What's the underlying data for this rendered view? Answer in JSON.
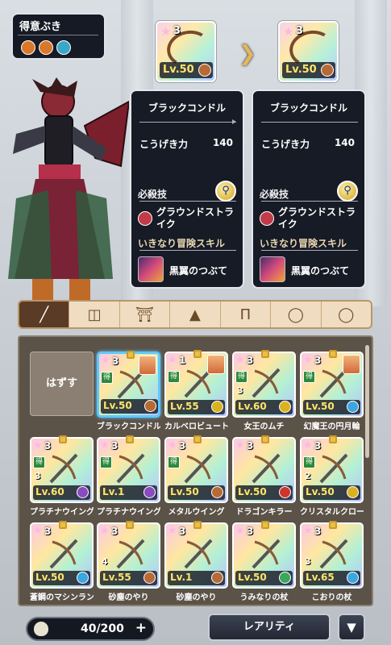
{
  "favorite": {
    "title": "得意ぶき",
    "icons": [
      {
        "name": "bow-type-icon",
        "color": "#d9782a"
      },
      {
        "name": "whip-type-icon",
        "color": "#d9782a"
      },
      {
        "name": "claw-type-icon",
        "color": "#3aa7c9"
      }
    ]
  },
  "preview": {
    "current": {
      "stars": "3",
      "level": "Lv.50"
    },
    "next": {
      "stars": "3",
      "level": "Lv.50"
    }
  },
  "panels": [
    {
      "name": "ブラックコンドル",
      "attack_label": "こうげき力",
      "attack_value": "140",
      "special_label": "必殺技",
      "skill_name": "グラウンドストライク",
      "adventure_label": "いきなり冒険スキル",
      "adventure_skill": "黒翼のつぶて"
    },
    {
      "name": "ブラックコンドル",
      "attack_label": "こうげき力",
      "attack_value": "140",
      "special_label": "必殺技",
      "skill_name": "グラウンドストライク",
      "adventure_label": "いきなり冒険スキル",
      "adventure_skill": "黒翼のつぶて"
    }
  ],
  "tabs": [
    {
      "name": "weapon",
      "icon": "sword-icon"
    },
    {
      "name": "shield",
      "icon": "shield-icon"
    },
    {
      "name": "head",
      "icon": "helmet-icon"
    },
    {
      "name": "body-top",
      "icon": "armor-icon"
    },
    {
      "name": "body-bottom",
      "icon": "pants-icon"
    },
    {
      "name": "accessory1",
      "icon": "ring-icon"
    },
    {
      "name": "accessory2",
      "icon": "ring-icon"
    }
  ],
  "unequip_label": "はずす",
  "items": [
    {
      "name": "ブラックコンドル",
      "stars": "3",
      "level": "Lv.50",
      "elem": "#b86a34",
      "toku": true,
      "plus": "",
      "selected": true,
      "avatar": true
    },
    {
      "name": "カルベロビュート",
      "stars": "1",
      "level": "Lv.55",
      "elem": "#d9b21e",
      "toku": true,
      "plus": "",
      "selected": false,
      "avatar": true
    },
    {
      "name": "女王のムチ",
      "stars": "3",
      "level": "Lv.60",
      "elem": "#d9b21e",
      "toku": true,
      "plus": "3",
      "selected": false,
      "avatar": false
    },
    {
      "name": "幻魔王の円月輪",
      "stars": "3",
      "level": "Lv.50",
      "elem": "#3aa7e0",
      "toku": true,
      "plus": "",
      "selected": false,
      "avatar": true
    },
    {
      "name": "プラチナウイング",
      "stars": "3",
      "level": "Lv.60",
      "elem": "#8a4bc0",
      "toku": true,
      "plus": "3",
      "selected": false,
      "avatar": false
    },
    {
      "name": "プラチナウイング",
      "stars": "3",
      "level": "Lv.1",
      "elem": "#8a4bc0",
      "toku": true,
      "plus": "",
      "selected": false,
      "avatar": false
    },
    {
      "name": "メタルウイング",
      "stars": "3",
      "level": "Lv.50",
      "elem": "#b86a34",
      "toku": true,
      "plus": "",
      "selected": false,
      "avatar": false
    },
    {
      "name": "ドラゴンキラー",
      "stars": "3",
      "level": "Lv.50",
      "elem": "#d0342c",
      "toku": false,
      "plus": "",
      "selected": false,
      "avatar": false
    },
    {
      "name": "クリスタルクロー",
      "stars": "3",
      "level": "Lv.50",
      "elem": "#d9b21e",
      "toku": true,
      "plus": "2",
      "selected": false,
      "avatar": false
    },
    {
      "name": "蒼鋼のマシンランス",
      "stars": "3",
      "level": "Lv.50",
      "elem": "#3aa7e0",
      "toku": false,
      "plus": "",
      "selected": false,
      "avatar": false
    },
    {
      "name": "砂塵のやり",
      "stars": "3",
      "level": "Lv.55",
      "elem": "#b86a34",
      "toku": false,
      "plus": "4",
      "selected": false,
      "avatar": false
    },
    {
      "name": "砂塵のやり",
      "stars": "3",
      "level": "Lv.1",
      "elem": "#b86a34",
      "toku": false,
      "plus": "",
      "selected": false,
      "avatar": false
    },
    {
      "name": "うみなりの杖",
      "stars": "3",
      "level": "Lv.50",
      "elem": "#3aa75a",
      "toku": false,
      "plus": "",
      "selected": false,
      "avatar": false
    },
    {
      "name": "こおりの杖",
      "stars": "3",
      "level": "Lv.65",
      "elem": "#3aa7e0",
      "toku": false,
      "plus": "3",
      "selected": false,
      "avatar": false
    }
  ],
  "bag": {
    "count": "40/200",
    "plus": "+"
  },
  "sort_label": "レアリティ",
  "sort_dir": "▼"
}
